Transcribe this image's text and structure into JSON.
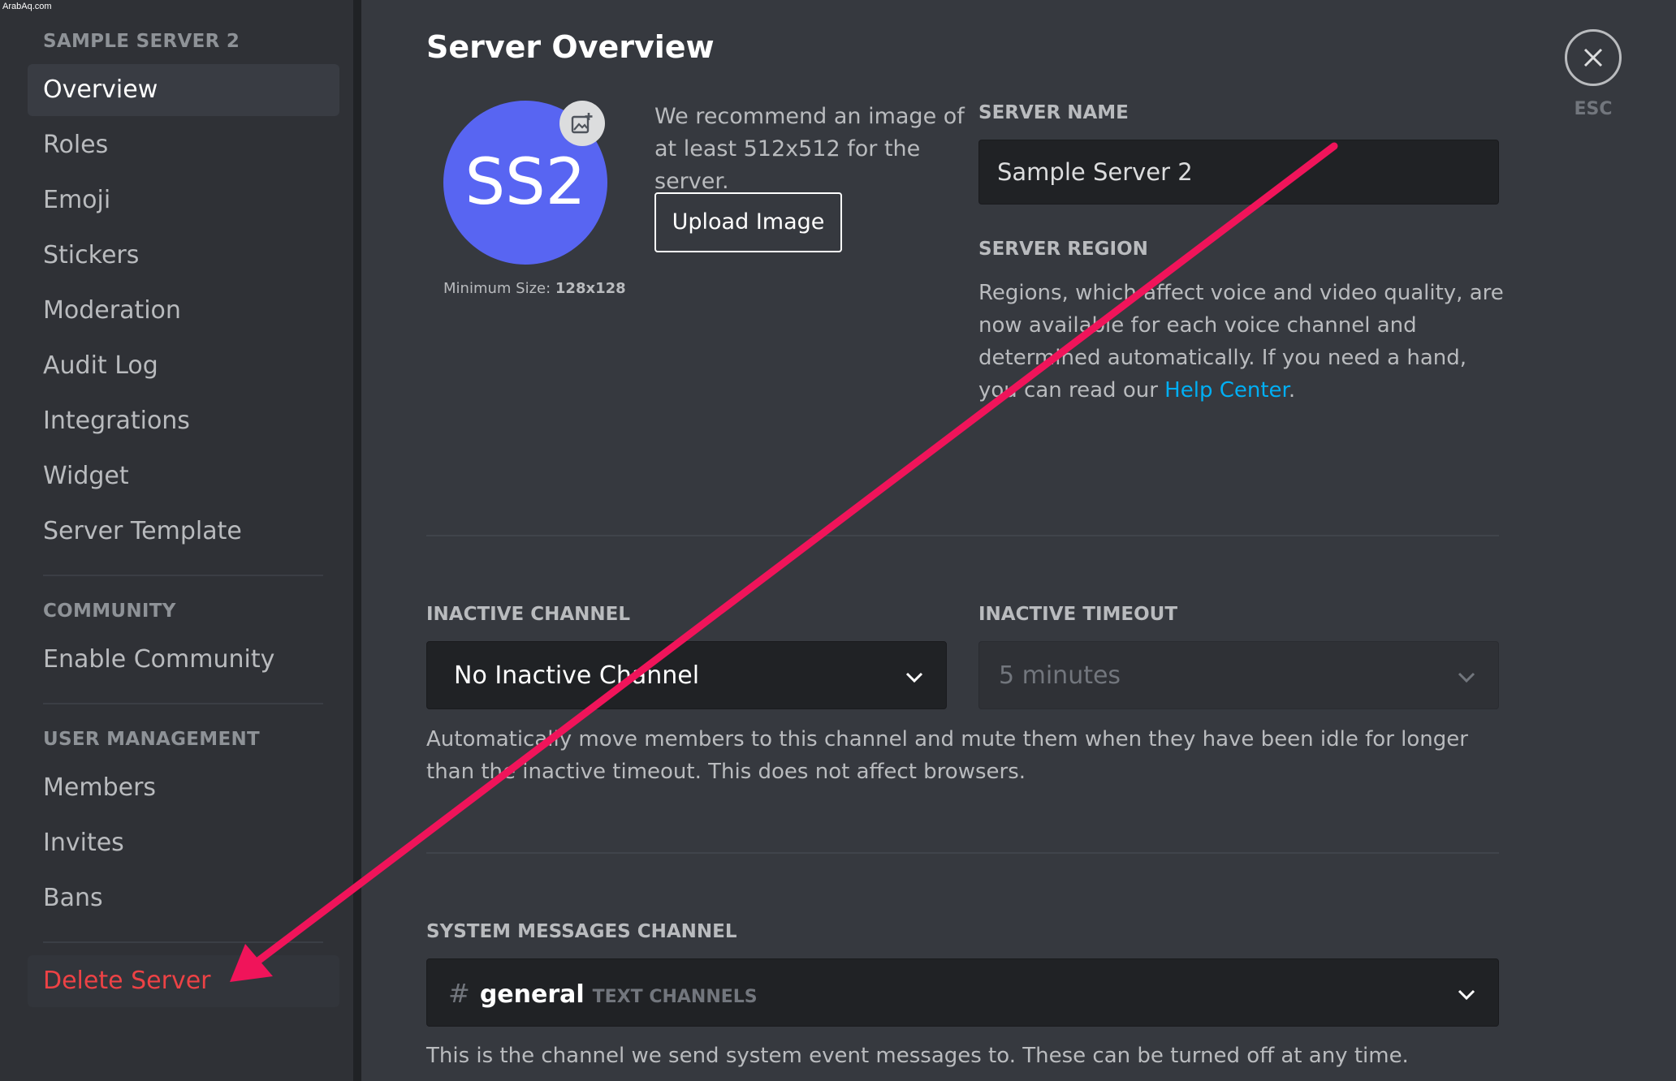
{
  "watermark": "ArabAq.com",
  "sidebar": {
    "server_header": "SAMPLE SERVER 2",
    "items": [
      {
        "label": "Overview"
      },
      {
        "label": "Roles"
      },
      {
        "label": "Emoji"
      },
      {
        "label": "Stickers"
      },
      {
        "label": "Moderation"
      },
      {
        "label": "Audit Log"
      },
      {
        "label": "Integrations"
      },
      {
        "label": "Widget"
      },
      {
        "label": "Server Template"
      }
    ],
    "community_header": "COMMUNITY",
    "community_items": [
      {
        "label": "Enable Community"
      }
    ],
    "user_mgmt_header": "USER MANAGEMENT",
    "user_mgmt_items": [
      {
        "label": "Members"
      },
      {
        "label": "Invites"
      },
      {
        "label": "Bans"
      }
    ],
    "delete_label": "Delete Server",
    "selected": "Overview"
  },
  "main": {
    "title": "Server Overview",
    "avatar_initials": "SS2",
    "min_size_label": "Minimum Size:",
    "min_size_value": "128x128",
    "recommend_text": "We recommend an image of at least 512x512 for the server.",
    "upload_button": "Upload Image",
    "server_name_label": "SERVER NAME",
    "server_name_value": "Sample Server 2",
    "server_region_label": "SERVER REGION",
    "region_desc": "Regions, which affect voice and video quality, are now available for each voice channel and determined automatically. If you need a hand, you can read our",
    "region_link": "Help Center",
    "region_period": ".",
    "inactive_channel_label": "INACTIVE CHANNEL",
    "inactive_channel_value": "No Inactive Channel",
    "inactive_timeout_label": "INACTIVE TIMEOUT",
    "inactive_timeout_value": "5 minutes",
    "inactive_help": "Automatically move members to this channel and mute them when they have been idle for longer than the inactive timeout. This does not affect browsers.",
    "system_channel_label": "SYSTEM MESSAGES CHANNEL",
    "system_channel_hash": "#",
    "system_channel_name": "general",
    "system_channel_category": "TEXT CHANNELS",
    "system_help": "This is the channel we send system event messages to. These can be turned off at any time.",
    "esc_label": "ESC"
  },
  "colors": {
    "background": "#36393f",
    "sidebar": "#2f3136",
    "brand": "#5865f2",
    "danger": "#ed4245",
    "link": "#00aff4",
    "arrow": "#f0145a"
  }
}
